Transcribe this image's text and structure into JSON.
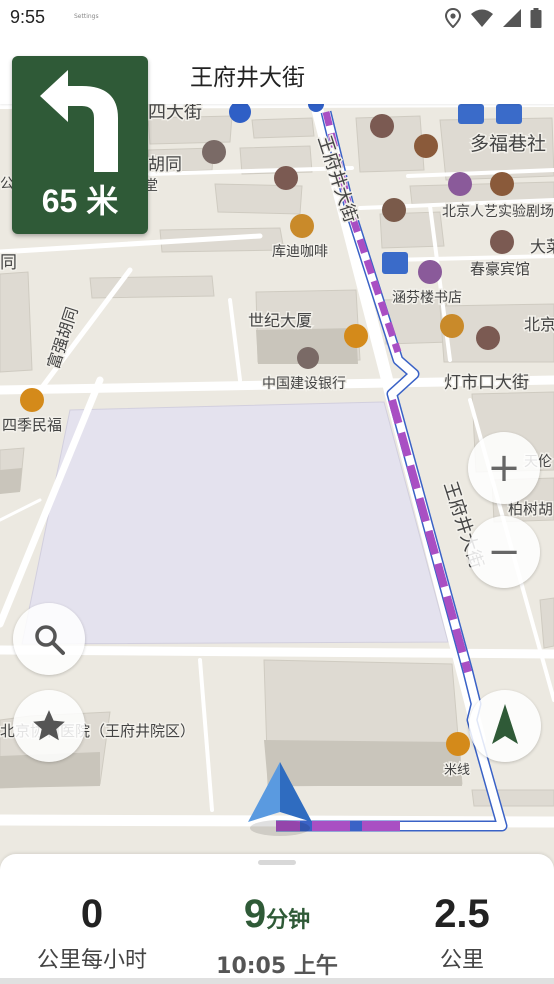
{
  "status_bar": {
    "time": "9:55",
    "app_label": "Settings"
  },
  "header": {
    "street_name": "王府井大街"
  },
  "turn": {
    "distance": "65 米",
    "direction": "left"
  },
  "map": {
    "roads": {
      "wangfujing_top": "王府井大街",
      "wangfujing_bottom": "王府井大街",
      "fuqiang": "富强胡同",
      "dengshikou": "灯市口大街",
      "xisi_partial": "四大街",
      "hutong_partial": "胡同",
      "left_tong": "同",
      "left_gong": "公"
    },
    "pois": {
      "duofu": "多福巷社",
      "renyi": "北京人艺实验剧场",
      "kudi": "库迪咖啡",
      "chunhao": "春豪宾馆",
      "hanfen": "涵芬楼书店",
      "shiji": "世纪大厦",
      "ccb": "中国建设银行",
      "siji": "四季民福",
      "beijing_right": "北京",
      "dada": "大菜",
      "tianlun": "天伦",
      "baishu": "柏树胡",
      "hospital": "北京协和医院（王府井院区）",
      "mixian": "米线",
      "dian_partial": "堂",
      "hospital_left": "幂"
    }
  },
  "controls": {
    "zoom_in": "+",
    "zoom_out": "−"
  },
  "stats": {
    "speed_value": "0",
    "speed_label": "公里每小时",
    "eta_minutes": "9",
    "eta_unit": "分钟",
    "arrival_time": "10:05 上午",
    "distance_value": "2.5",
    "distance_label": "公里"
  },
  "colors": {
    "turn_card": "#2f5a37",
    "route": "#a94fc3",
    "map_bg": "#ece9e1",
    "building": "#d9d5cc",
    "park": "#e4e2ee"
  }
}
